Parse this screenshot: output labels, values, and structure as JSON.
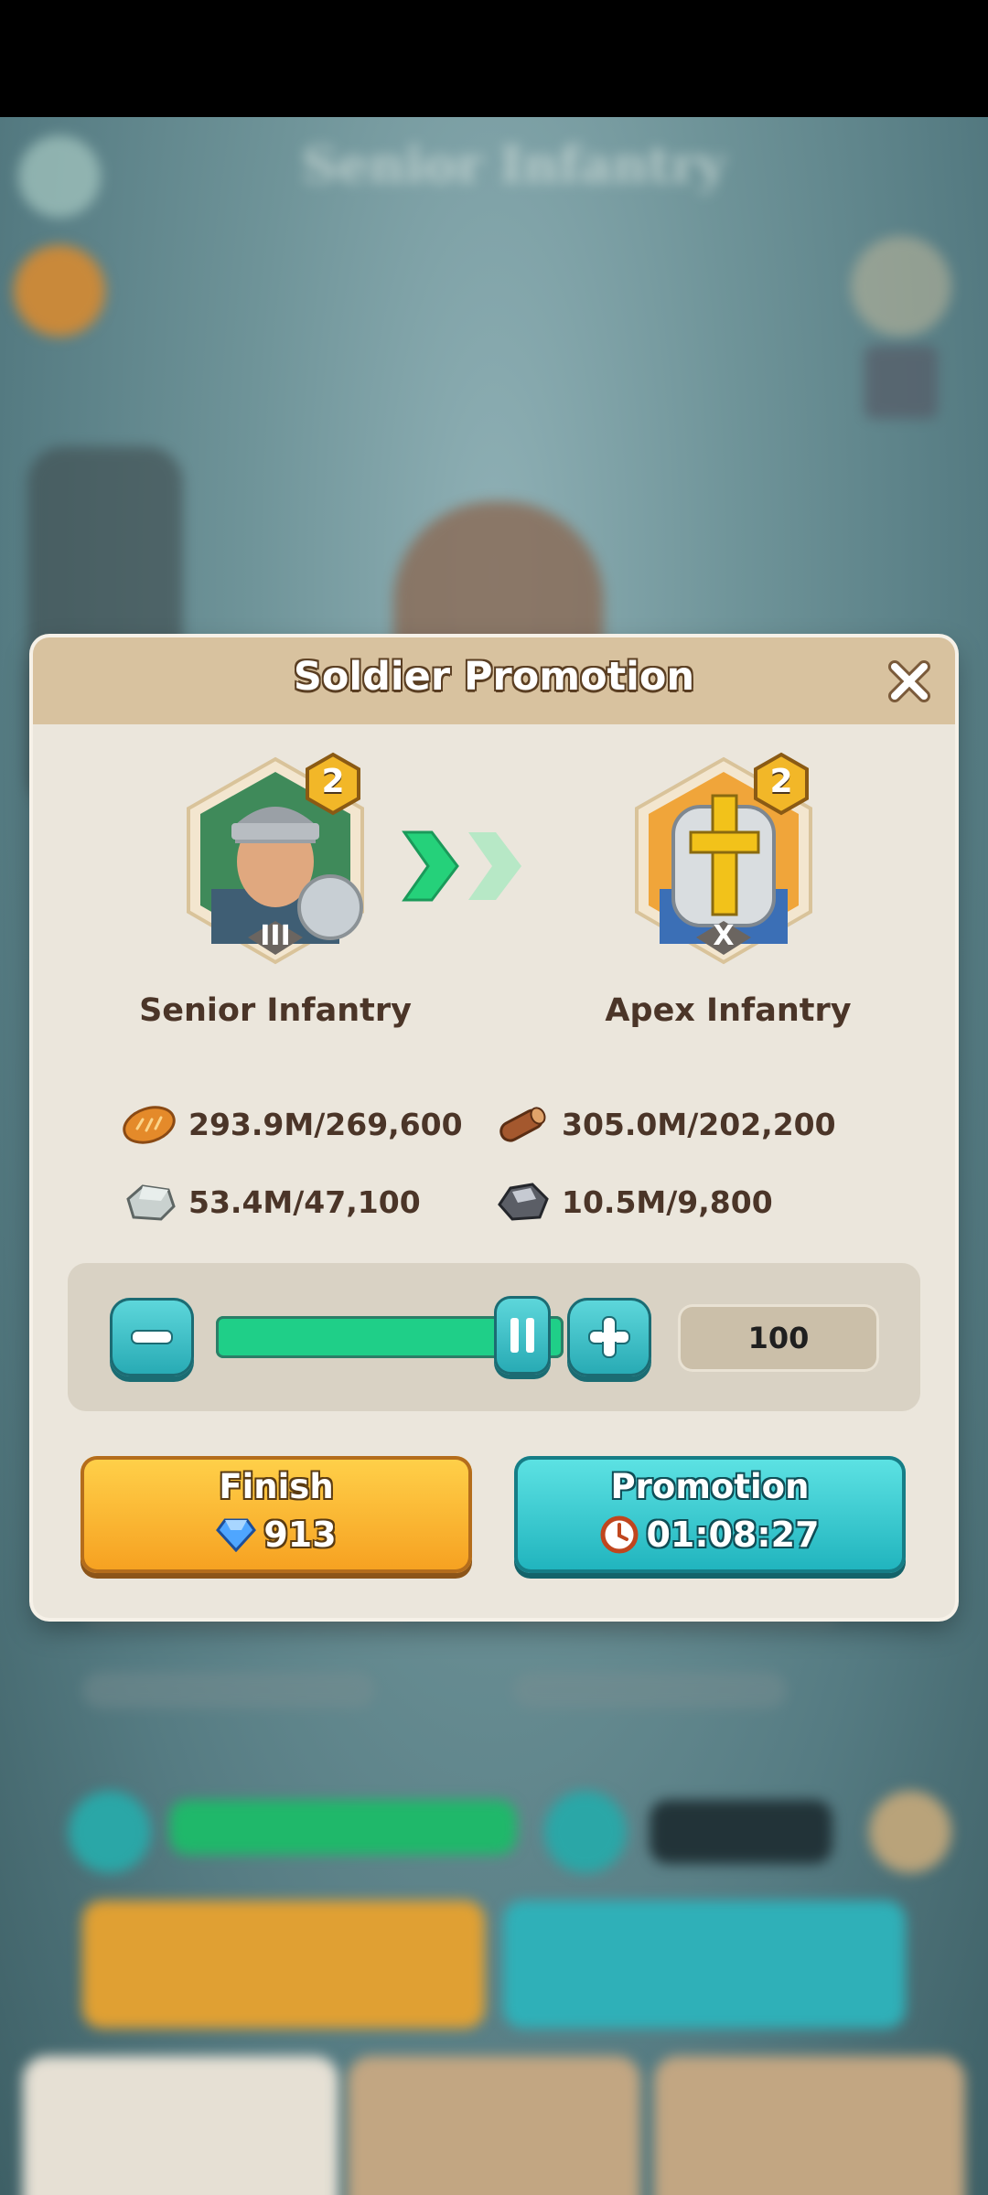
{
  "background": {
    "title": "Senior Infantry"
  },
  "dialog": {
    "title": "Soldier Promotion",
    "from_unit": {
      "name": "Senior Infantry",
      "tier": "2",
      "rank": "III"
    },
    "to_unit": {
      "name": "Apex Infantry",
      "tier": "2",
      "rank": "X"
    },
    "resources": [
      {
        "icon": "bread-icon",
        "text": "293.9M/269,600"
      },
      {
        "icon": "wood-log-icon",
        "text": "305.0M/202,200"
      },
      {
        "icon": "stone-icon",
        "text": "53.4M/47,100"
      },
      {
        "icon": "iron-ore-icon",
        "text": "10.5M/9,800"
      }
    ],
    "slider": {
      "level_fraction": 1.0
    },
    "quantity": "100",
    "finish": {
      "label": "Finish",
      "gems": "913",
      "icon": "diamond-icon"
    },
    "promotion": {
      "label": "Promotion",
      "time": "01:08:27",
      "icon": "clock-icon"
    }
  },
  "colors": {
    "header": "#d8c29f",
    "panel": "#ebe6dc",
    "finish_button": "#f6a020",
    "promotion_button": "#1fb3bd",
    "slider_fill": "#1fcf88"
  }
}
